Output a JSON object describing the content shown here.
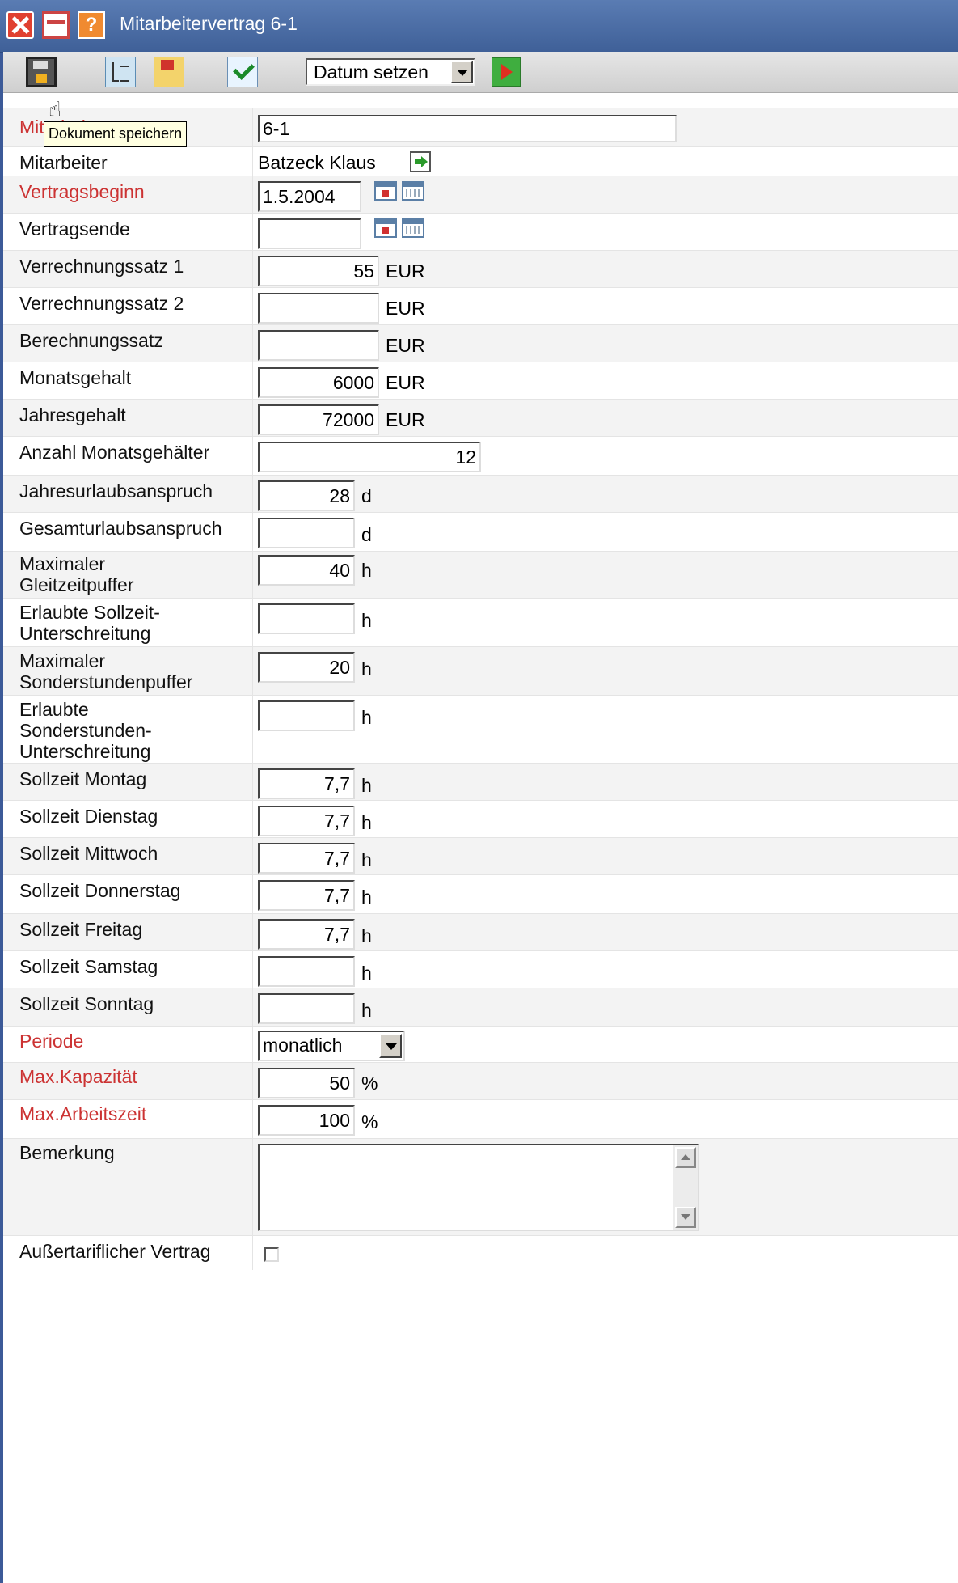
{
  "window": {
    "title": "Mitarbeitervertrag 6-1"
  },
  "toolbar": {
    "date_select_value": "Datum setzen",
    "tooltip": "Dokument speichern"
  },
  "form": {
    "mitarbeitervertrag": {
      "label": "Mitarbeitervertrag",
      "value": "6-1"
    },
    "mitarbeiter": {
      "label": "Mitarbeiter",
      "value": "Batzeck Klaus"
    },
    "vertragsbeginn": {
      "label": "Vertragsbeginn",
      "value": "1.5.2004"
    },
    "vertragsende": {
      "label": "Vertragsende",
      "value": ""
    },
    "verrechnungssatz1": {
      "label": "Verrechnungssatz 1",
      "value": "55",
      "unit": "EUR"
    },
    "verrechnungssatz2": {
      "label": "Verrechnungssatz 2",
      "value": "",
      "unit": "EUR"
    },
    "berechnungssatz": {
      "label": "Berechnungssatz",
      "value": "",
      "unit": "EUR"
    },
    "monatsgehalt": {
      "label": "Monatsgehalt",
      "value": "6000",
      "unit": "EUR"
    },
    "jahresgehalt": {
      "label": "Jahresgehalt",
      "value": "72000",
      "unit": "EUR"
    },
    "anzahl_monatsgehaelter": {
      "label": "Anzahl Monatsgehälter",
      "value": "12"
    },
    "jahresurlaubsanspruch": {
      "label": "Jahresurlaubsanspruch",
      "value": "28",
      "unit": "d"
    },
    "gesamturlaubsanspruch": {
      "label": "Gesamturlaubsanspruch",
      "value": "",
      "unit": "d"
    },
    "max_gleitzeitpuffer": {
      "label_line1": "Maximaler",
      "label_line2": "Gleitzeitpuffer",
      "value": "40",
      "unit": "h"
    },
    "erlaubte_sollzeit_unterschreitung": {
      "label_line1": "Erlaubte Sollzeit-",
      "label_line2": "Unterschreitung",
      "value": "",
      "unit": "h"
    },
    "max_sonderstundenpuffer": {
      "label_line1": "Maximaler",
      "label_line2": "Sonderstundenpuffer",
      "value": "20",
      "unit": "h"
    },
    "erlaubte_sonderstunden_unterschreitung": {
      "label_line1": "Erlaubte",
      "label_line2": "Sonderstunden-",
      "label_line3": "Unterschreitung",
      "value": "",
      "unit": "h"
    },
    "sollzeit_montag": {
      "label": "Sollzeit Montag",
      "value": "7,7",
      "unit": "h"
    },
    "sollzeit_dienstag": {
      "label": "Sollzeit Dienstag",
      "value": "7,7",
      "unit": "h"
    },
    "sollzeit_mittwoch": {
      "label": "Sollzeit Mittwoch",
      "value": "7,7",
      "unit": "h"
    },
    "sollzeit_donnerstag": {
      "label": "Sollzeit Donnerstag",
      "value": "7,7",
      "unit": "h"
    },
    "sollzeit_freitag": {
      "label": "Sollzeit Freitag",
      "value": "7,7",
      "unit": "h"
    },
    "sollzeit_samstag": {
      "label": "Sollzeit Samstag",
      "value": "",
      "unit": "h"
    },
    "sollzeit_sonntag": {
      "label": "Sollzeit Sonntag",
      "value": "",
      "unit": "h"
    },
    "periode": {
      "label": "Periode",
      "value": "monatlich"
    },
    "max_kapazitaet": {
      "label": "Max.Kapazität",
      "value": "50",
      "unit": "%"
    },
    "max_arbeitszeit": {
      "label": "Max.Arbeitszeit",
      "value": "100",
      "unit": "%"
    },
    "bemerkung": {
      "label": "Bemerkung",
      "value": ""
    },
    "aussertariflicher_vertrag": {
      "label": "Außertariflicher Vertrag",
      "checked": false
    }
  },
  "colors": {
    "required_label": "#cc3333",
    "titlebar": "#4d6fa7",
    "tooltip_bg": "#ffffe1"
  }
}
